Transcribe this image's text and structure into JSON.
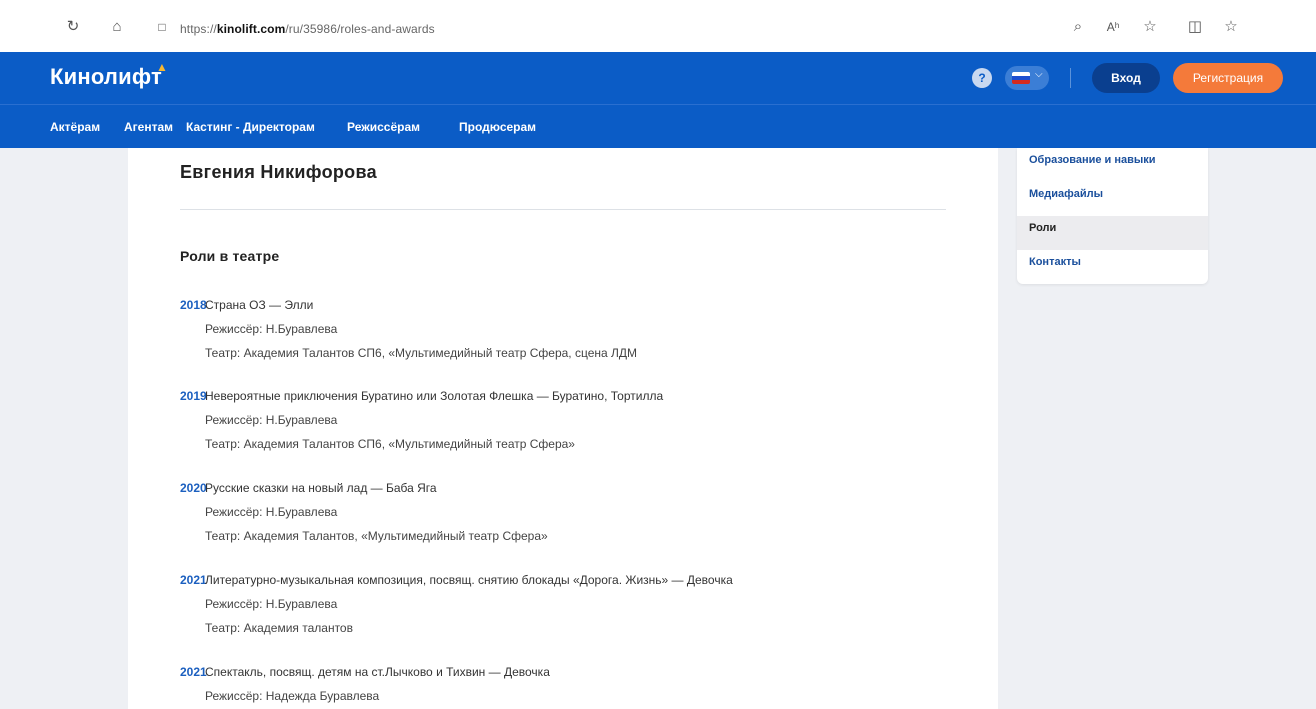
{
  "browser": {
    "url_prefix": "https://",
    "url_domain": "kinolift.com",
    "url_path": "/ru/35986/roles-and-awards"
  },
  "header": {
    "logo": "Кинолифт",
    "help_label": "?",
    "login_label": "Вход",
    "register_label": "Регистрация"
  },
  "nav": {
    "items": [
      "Актёрам",
      "Агентам",
      "Кастинг - Директорам",
      "Режиссёрам",
      "Продюсерам"
    ]
  },
  "profile": {
    "name": "Евгения Никифорова",
    "section_title": "Роли в театре",
    "roles": [
      {
        "year": "2018",
        "title": "Страна ОЗ — Элли",
        "director": "Режиссёр: Н.Буравлева",
        "theatre": "Театр: Академия Талантов СП6, «Мультимедийный театр Сфера, сцена ЛДМ"
      },
      {
        "year": "2019",
        "title": "Невероятные приключения Буратино или Золотая Флешка — Буратино, Тортилла",
        "director": "Режиссёр: Н.Буравлева",
        "theatre": "Театр: Академия Талантов СП6, «Мультимедийный театр Сфера»"
      },
      {
        "year": "2020",
        "title": "Русские сказки на новый лад — Баба Яга",
        "director": "Режиссёр: Н.Буравлева",
        "theatre": "Театр: Академия Талантов, «Мультимедийный театр Сфера»"
      },
      {
        "year": "2021",
        "title": "Литературно-музыкальная композиция, посвящ. снятию блокады «Дорога. Жизнь» — Девочка",
        "director": "Режиссёр: Н.Буравлева",
        "theatre": "Театр: Академия талантов"
      },
      {
        "year": "2021",
        "title": "Спектакль, посвящ. детям на ст.Лычково и Тихвин — Девочка",
        "director": "Режиссёр: Надежда Буравлева",
        "theatre": ""
      }
    ]
  },
  "side_menu": {
    "items": [
      "Образование и навыки",
      "Медиафайлы",
      "Роли",
      "Контакты"
    ],
    "active_index": 2
  },
  "colors": {
    "brand_blue": "#0b5cc6",
    "accent_orange": "#f47a3a",
    "year_blue": "#1b5fbf"
  }
}
